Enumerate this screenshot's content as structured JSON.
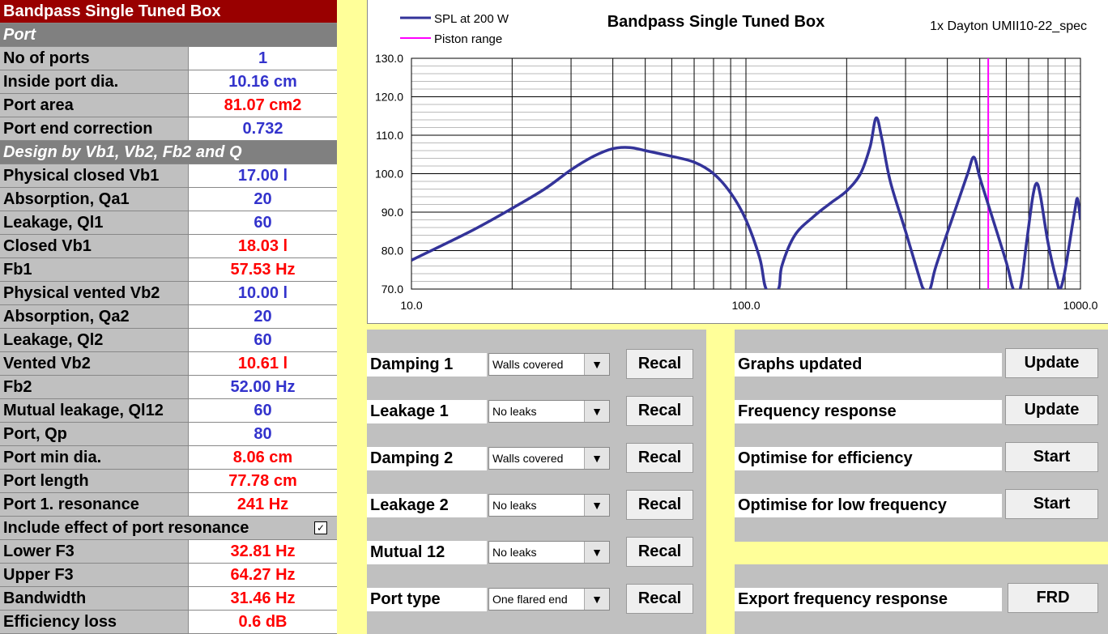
{
  "left_panel": {
    "title": "Bandpass Single Tuned Box",
    "section_port": "Port",
    "section_design": "Design by Vb1, Vb2, Fb2 and Q",
    "rows": [
      {
        "label": "No of ports",
        "value": "1",
        "color": "blue"
      },
      {
        "label": "Inside port dia.",
        "value": "10.16 cm",
        "color": "blue"
      },
      {
        "label": "Port area",
        "value": "81.07 cm2",
        "color": "red"
      },
      {
        "label": "Port end correction",
        "value": "0.732",
        "color": "blue"
      },
      {
        "label": "Physical closed Vb1",
        "value": "17.00 l",
        "color": "blue"
      },
      {
        "label": "Absorption, Qa1",
        "value": "20",
        "color": "blue"
      },
      {
        "label": "Leakage, Ql1",
        "value": "60",
        "color": "blue"
      },
      {
        "label": "Closed Vb1",
        "value": "18.03 l",
        "color": "red"
      },
      {
        "label": "Fb1",
        "value": "57.53 Hz",
        "color": "red"
      },
      {
        "label": "Physical vented Vb2",
        "value": "10.00 l",
        "color": "blue"
      },
      {
        "label": "Absorption, Qa2",
        "value": "20",
        "color": "blue"
      },
      {
        "label": "Leakage, Ql2",
        "value": "60",
        "color": "blue"
      },
      {
        "label": "Vented Vb2",
        "value": "10.61 l",
        "color": "red"
      },
      {
        "label": "Fb2",
        "value": "52.00 Hz",
        "color": "blue"
      },
      {
        "label": "Mutual leakage, Ql12",
        "value": "60",
        "color": "blue"
      },
      {
        "label": "Port, Qp",
        "value": "80",
        "color": "blue"
      },
      {
        "label": "Port min dia.",
        "value": "8.06 cm",
        "color": "red"
      },
      {
        "label": "Port length",
        "value": "77.78 cm",
        "color": "red"
      },
      {
        "label": "Port 1. resonance",
        "value": "241 Hz",
        "color": "red"
      },
      {
        "label": "Include effect of port resonance",
        "value": "",
        "color": "blue",
        "checkbox": true,
        "checked_mark": "✓"
      },
      {
        "label": "Lower F3",
        "value": "32.81 Hz",
        "color": "red"
      },
      {
        "label": "Upper F3",
        "value": "64.27 Hz",
        "color": "red"
      },
      {
        "label": "Bandwidth",
        "value": "31.46 Hz",
        "color": "red"
      },
      {
        "label": "Efficiency loss",
        "value": "0.6 dB",
        "color": "red"
      }
    ]
  },
  "chart_data": {
    "type": "line",
    "title": "Bandpass Single Tuned Box",
    "subtitle": "1x Dayton UMII10-22_spec",
    "x_scale": "log",
    "xlim": [
      10,
      1000
    ],
    "ylim": [
      70,
      130
    ],
    "x_ticks": [
      "10.0",
      "100.0",
      "1000.0"
    ],
    "y_ticks": [
      "130.0",
      "120.0",
      "110.0",
      "100.0",
      "90.0",
      "80.0",
      "70.0"
    ],
    "grid": true,
    "legend_position": "top-left",
    "series": [
      {
        "name": "SPL at 200 W",
        "color": "#333399",
        "points": [
          [
            10,
            77.5
          ],
          [
            15,
            85
          ],
          [
            20,
            91
          ],
          [
            25,
            96
          ],
          [
            30,
            101
          ],
          [
            35,
            104.5
          ],
          [
            40,
            106.5
          ],
          [
            45,
            106.8
          ],
          [
            50,
            106
          ],
          [
            60,
            104.5
          ],
          [
            70,
            103
          ],
          [
            80,
            100
          ],
          [
            90,
            95
          ],
          [
            100,
            88
          ],
          [
            110,
            78
          ],
          [
            115,
            70
          ],
          [
            125,
            70
          ],
          [
            128,
            76
          ],
          [
            140,
            84
          ],
          [
            160,
            89
          ],
          [
            180,
            92.5
          ],
          [
            200,
            95.5
          ],
          [
            220,
            100
          ],
          [
            235,
            107
          ],
          [
            245,
            114.5
          ],
          [
            255,
            109
          ],
          [
            270,
            98
          ],
          [
            300,
            85
          ],
          [
            330,
            73
          ],
          [
            340,
            70
          ],
          [
            355,
            70
          ],
          [
            370,
            76
          ],
          [
            420,
            90
          ],
          [
            460,
            100
          ],
          [
            480,
            104.3
          ],
          [
            500,
            99
          ],
          [
            530,
            92
          ],
          [
            600,
            77
          ],
          [
            630,
            70
          ],
          [
            660,
            70
          ],
          [
            690,
            82
          ],
          [
            720,
            94
          ],
          [
            740,
            97.5
          ],
          [
            760,
            94
          ],
          [
            800,
            82
          ],
          [
            850,
            72
          ],
          [
            870,
            70
          ],
          [
            900,
            75
          ],
          [
            960,
            90
          ],
          [
            980,
            93.5
          ],
          [
            1000,
            88
          ]
        ]
      },
      {
        "name": "Piston range",
        "color": "#ff00ff",
        "vline_x": 530
      }
    ]
  },
  "controls_left": [
    {
      "label": "Damping 1",
      "select": "Walls covered",
      "button": "Recal"
    },
    {
      "label": "Leakage 1",
      "select": "No leaks",
      "button": "Recal"
    },
    {
      "label": "Damping 2",
      "select": "Walls covered",
      "button": "Recal"
    },
    {
      "label": "Leakage 2",
      "select": "No leaks",
      "button": "Recal"
    },
    {
      "label": "Mutual 12",
      "select": "No leaks",
      "button": "Recal"
    },
    {
      "label": "Port type",
      "select": "One flared end",
      "button": "Recal"
    }
  ],
  "controls_right": [
    {
      "label": "Graphs updated",
      "button": "Update"
    },
    {
      "label": "Frequency response",
      "button": "Update"
    },
    {
      "label": "Optimise for efficiency",
      "button": "Start"
    },
    {
      "label": "Optimise for low frequency",
      "button": "Start"
    }
  ],
  "export": {
    "label": "Export frequency response",
    "button": "FRD"
  },
  "icons": {
    "dropdown": "chevron-down-icon",
    "checkbox": "checkbox-icon"
  }
}
